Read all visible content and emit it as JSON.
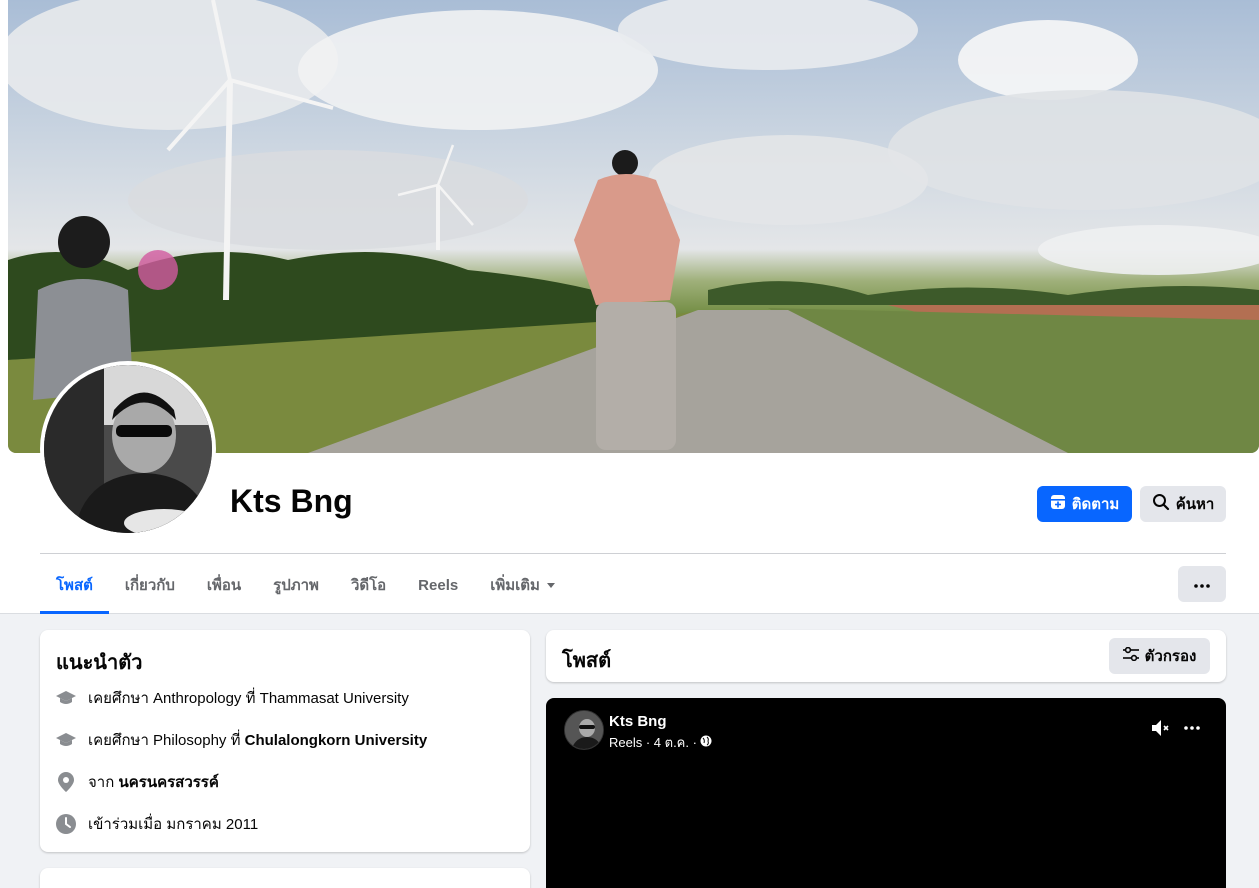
{
  "profile": {
    "name": "Kts Bng",
    "follow_label": "ติดตาม",
    "search_label": "ค้นหา"
  },
  "tabs": [
    {
      "label": "โพสต์",
      "active": true
    },
    {
      "label": "เกี่ยวกับ",
      "active": false
    },
    {
      "label": "เพื่อน",
      "active": false
    },
    {
      "label": "รูปภาพ",
      "active": false
    },
    {
      "label": "วิดีโอ",
      "active": false
    },
    {
      "label": "Reels",
      "active": false
    },
    {
      "label": "เพิ่มเติม",
      "active": false
    }
  ],
  "intro": {
    "title": "แนะนำตัว",
    "education1": {
      "prefix": "เคยศึกษา Anthropology ที่ Thammasat University"
    },
    "education2": {
      "prefix": "เคยศึกษา Philosophy ที่ ",
      "school": "Chulalongkorn University"
    },
    "location": {
      "prefix": "จาก ",
      "place": "นครนครสวรรค์"
    },
    "joined": {
      "text": "เข้าร่วมเมื่อ มกราคม 2011"
    }
  },
  "posts": {
    "title": "โพสต์",
    "filter_label": "ตัวกรอง"
  },
  "reel_post": {
    "author": "Kts Bng",
    "meta": "Reels · 4 ต.ค. ·"
  },
  "colors": {
    "accent": "#0866ff",
    "button_gray": "#e4e6eb",
    "background": "#f0f2f5"
  }
}
